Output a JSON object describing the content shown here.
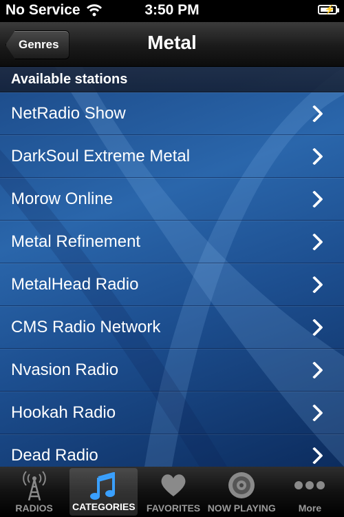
{
  "status_bar": {
    "carrier": "No Service",
    "time": "3:50 PM"
  },
  "nav": {
    "back_label": "Genres",
    "title": "Metal"
  },
  "section_header": "Available stations",
  "stations": [
    "NetRadio Show",
    "DarkSoul Extreme Metal",
    "Morow Online",
    "Metal Refinement",
    "MetalHead Radio",
    "CMS Radio Network",
    "Nvasion Radio",
    "Hookah Radio",
    "Dead Radio"
  ],
  "tabs": [
    {
      "label": "RADIOS",
      "icon": "radio-tower-icon",
      "active": false
    },
    {
      "label": "CATEGORIES",
      "icon": "music-note-icon",
      "active": true
    },
    {
      "label": "FAVORITES",
      "icon": "heart-icon",
      "active": false
    },
    {
      "label": "NOW PLAYING",
      "icon": "speaker-icon",
      "active": false
    },
    {
      "label": "More",
      "icon": "more-dots-icon",
      "active": false
    }
  ],
  "colors": {
    "list_background": "#1f4f8f",
    "active_tab_icon": "#3aa0ff"
  }
}
